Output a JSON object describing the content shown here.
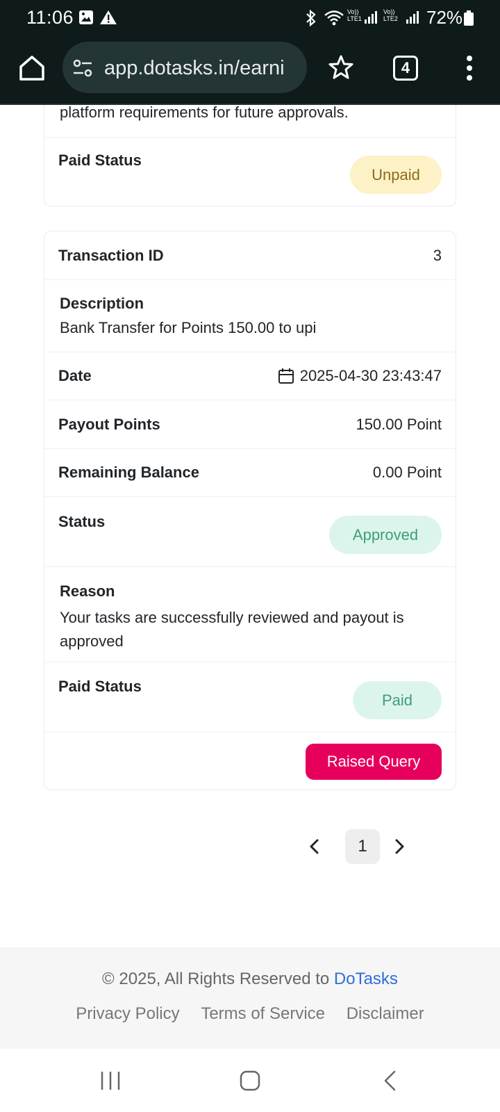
{
  "status_bar": {
    "time": "11:06",
    "battery": "72%",
    "sim1": "LTE1",
    "sim2": "LTE2"
  },
  "browser": {
    "url": "app.dotasks.in/earni",
    "tab_count": "4"
  },
  "prev_card": {
    "reason_tail": "platform requirements for future approvals.",
    "paid_status_label": "Paid Status",
    "paid_status_value": "Unpaid"
  },
  "transaction": {
    "id_label": "Transaction ID",
    "id_value": "3",
    "description_label": "Description",
    "description_value": "Bank Transfer for Points 150.00 to upi",
    "date_label": "Date",
    "date_value": "2025-04-30 23:43:47",
    "payout_label": "Payout Points",
    "payout_value": "150.00 Point",
    "balance_label": "Remaining Balance",
    "balance_value": "0.00 Point",
    "status_label": "Status",
    "status_value": "Approved",
    "reason_label": "Reason",
    "reason_value": "Your tasks are successfully reviewed and payout is approved",
    "paid_status_label": "Paid Status",
    "paid_status_value": "Paid",
    "query_button": "Raised Query"
  },
  "pagination": {
    "current_page": "1"
  },
  "footer": {
    "copyright_prefix": "© 2025, All Rights Reserved to",
    "brand": "DoTasks",
    "links": [
      "Privacy Policy",
      "Terms of Service",
      "Disclaimer"
    ]
  },
  "colors": {
    "accent_pink": "#e6005c",
    "brand_blue": "#2f6fd6",
    "approved_bg": "#dcf5ec",
    "unpaid_bg": "#fdf1c7"
  }
}
